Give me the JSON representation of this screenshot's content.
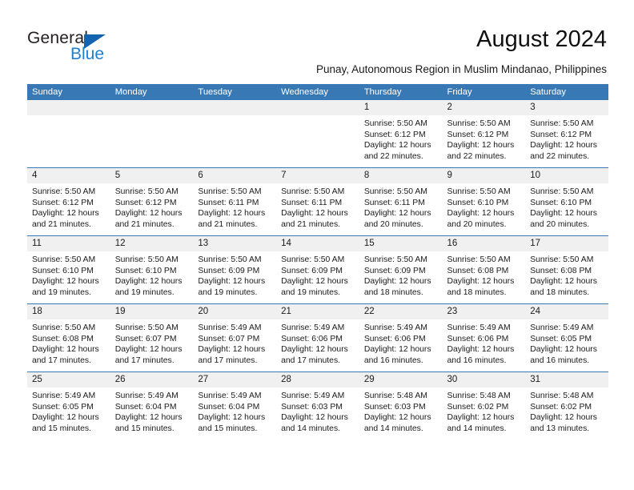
{
  "brand": {
    "name_top": "General",
    "name_bottom": "Blue",
    "accent_color": "#1f7fd0",
    "triangle_color": "#1464af"
  },
  "header": {
    "month_title": "August 2024",
    "location": "Punay, Autonomous Region in Muslim Mindanao, Philippines"
  },
  "calendar": {
    "header_bg": "#3878b4",
    "daynum_bg": "#f0f0f0",
    "weekday_headers": [
      "Sunday",
      "Monday",
      "Tuesday",
      "Wednesday",
      "Thursday",
      "Friday",
      "Saturday"
    ],
    "weeks": [
      [
        {
          "day": "",
          "empty": true,
          "lines": []
        },
        {
          "day": "",
          "empty": true,
          "lines": []
        },
        {
          "day": "",
          "empty": true,
          "lines": []
        },
        {
          "day": "",
          "empty": true,
          "lines": []
        },
        {
          "day": "1",
          "empty": false,
          "lines": [
            "Sunrise: 5:50 AM",
            "Sunset: 6:12 PM",
            "Daylight: 12 hours",
            "and 22 minutes."
          ]
        },
        {
          "day": "2",
          "empty": false,
          "lines": [
            "Sunrise: 5:50 AM",
            "Sunset: 6:12 PM",
            "Daylight: 12 hours",
            "and 22 minutes."
          ]
        },
        {
          "day": "3",
          "empty": false,
          "lines": [
            "Sunrise: 5:50 AM",
            "Sunset: 6:12 PM",
            "Daylight: 12 hours",
            "and 22 minutes."
          ]
        }
      ],
      [
        {
          "day": "4",
          "empty": false,
          "lines": [
            "Sunrise: 5:50 AM",
            "Sunset: 6:12 PM",
            "Daylight: 12 hours",
            "and 21 minutes."
          ]
        },
        {
          "day": "5",
          "empty": false,
          "lines": [
            "Sunrise: 5:50 AM",
            "Sunset: 6:12 PM",
            "Daylight: 12 hours",
            "and 21 minutes."
          ]
        },
        {
          "day": "6",
          "empty": false,
          "lines": [
            "Sunrise: 5:50 AM",
            "Sunset: 6:11 PM",
            "Daylight: 12 hours",
            "and 21 minutes."
          ]
        },
        {
          "day": "7",
          "empty": false,
          "lines": [
            "Sunrise: 5:50 AM",
            "Sunset: 6:11 PM",
            "Daylight: 12 hours",
            "and 21 minutes."
          ]
        },
        {
          "day": "8",
          "empty": false,
          "lines": [
            "Sunrise: 5:50 AM",
            "Sunset: 6:11 PM",
            "Daylight: 12 hours",
            "and 20 minutes."
          ]
        },
        {
          "day": "9",
          "empty": false,
          "lines": [
            "Sunrise: 5:50 AM",
            "Sunset: 6:10 PM",
            "Daylight: 12 hours",
            "and 20 minutes."
          ]
        },
        {
          "day": "10",
          "empty": false,
          "lines": [
            "Sunrise: 5:50 AM",
            "Sunset: 6:10 PM",
            "Daylight: 12 hours",
            "and 20 minutes."
          ]
        }
      ],
      [
        {
          "day": "11",
          "empty": false,
          "lines": [
            "Sunrise: 5:50 AM",
            "Sunset: 6:10 PM",
            "Daylight: 12 hours",
            "and 19 minutes."
          ]
        },
        {
          "day": "12",
          "empty": false,
          "lines": [
            "Sunrise: 5:50 AM",
            "Sunset: 6:10 PM",
            "Daylight: 12 hours",
            "and 19 minutes."
          ]
        },
        {
          "day": "13",
          "empty": false,
          "lines": [
            "Sunrise: 5:50 AM",
            "Sunset: 6:09 PM",
            "Daylight: 12 hours",
            "and 19 minutes."
          ]
        },
        {
          "day": "14",
          "empty": false,
          "lines": [
            "Sunrise: 5:50 AM",
            "Sunset: 6:09 PM",
            "Daylight: 12 hours",
            "and 19 minutes."
          ]
        },
        {
          "day": "15",
          "empty": false,
          "lines": [
            "Sunrise: 5:50 AM",
            "Sunset: 6:09 PM",
            "Daylight: 12 hours",
            "and 18 minutes."
          ]
        },
        {
          "day": "16",
          "empty": false,
          "lines": [
            "Sunrise: 5:50 AM",
            "Sunset: 6:08 PM",
            "Daylight: 12 hours",
            "and 18 minutes."
          ]
        },
        {
          "day": "17",
          "empty": false,
          "lines": [
            "Sunrise: 5:50 AM",
            "Sunset: 6:08 PM",
            "Daylight: 12 hours",
            "and 18 minutes."
          ]
        }
      ],
      [
        {
          "day": "18",
          "empty": false,
          "lines": [
            "Sunrise: 5:50 AM",
            "Sunset: 6:08 PM",
            "Daylight: 12 hours",
            "and 17 minutes."
          ]
        },
        {
          "day": "19",
          "empty": false,
          "lines": [
            "Sunrise: 5:50 AM",
            "Sunset: 6:07 PM",
            "Daylight: 12 hours",
            "and 17 minutes."
          ]
        },
        {
          "day": "20",
          "empty": false,
          "lines": [
            "Sunrise: 5:49 AM",
            "Sunset: 6:07 PM",
            "Daylight: 12 hours",
            "and 17 minutes."
          ]
        },
        {
          "day": "21",
          "empty": false,
          "lines": [
            "Sunrise: 5:49 AM",
            "Sunset: 6:06 PM",
            "Daylight: 12 hours",
            "and 17 minutes."
          ]
        },
        {
          "day": "22",
          "empty": false,
          "lines": [
            "Sunrise: 5:49 AM",
            "Sunset: 6:06 PM",
            "Daylight: 12 hours",
            "and 16 minutes."
          ]
        },
        {
          "day": "23",
          "empty": false,
          "lines": [
            "Sunrise: 5:49 AM",
            "Sunset: 6:06 PM",
            "Daylight: 12 hours",
            "and 16 minutes."
          ]
        },
        {
          "day": "24",
          "empty": false,
          "lines": [
            "Sunrise: 5:49 AM",
            "Sunset: 6:05 PM",
            "Daylight: 12 hours",
            "and 16 minutes."
          ]
        }
      ],
      [
        {
          "day": "25",
          "empty": false,
          "lines": [
            "Sunrise: 5:49 AM",
            "Sunset: 6:05 PM",
            "Daylight: 12 hours",
            "and 15 minutes."
          ]
        },
        {
          "day": "26",
          "empty": false,
          "lines": [
            "Sunrise: 5:49 AM",
            "Sunset: 6:04 PM",
            "Daylight: 12 hours",
            "and 15 minutes."
          ]
        },
        {
          "day": "27",
          "empty": false,
          "lines": [
            "Sunrise: 5:49 AM",
            "Sunset: 6:04 PM",
            "Daylight: 12 hours",
            "and 15 minutes."
          ]
        },
        {
          "day": "28",
          "empty": false,
          "lines": [
            "Sunrise: 5:49 AM",
            "Sunset: 6:03 PM",
            "Daylight: 12 hours",
            "and 14 minutes."
          ]
        },
        {
          "day": "29",
          "empty": false,
          "lines": [
            "Sunrise: 5:48 AM",
            "Sunset: 6:03 PM",
            "Daylight: 12 hours",
            "and 14 minutes."
          ]
        },
        {
          "day": "30",
          "empty": false,
          "lines": [
            "Sunrise: 5:48 AM",
            "Sunset: 6:02 PM",
            "Daylight: 12 hours",
            "and 14 minutes."
          ]
        },
        {
          "day": "31",
          "empty": false,
          "lines": [
            "Sunrise: 5:48 AM",
            "Sunset: 6:02 PM",
            "Daylight: 12 hours",
            "and 13 minutes."
          ]
        }
      ]
    ]
  }
}
